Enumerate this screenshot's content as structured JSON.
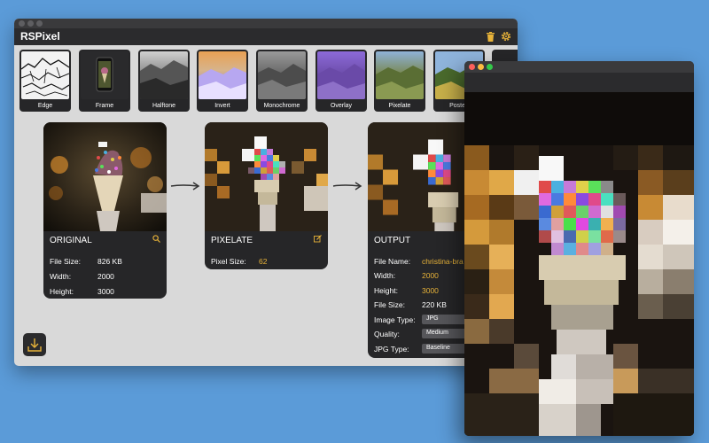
{
  "app": {
    "title": "RSPixel"
  },
  "filters": [
    {
      "label": "Edge"
    },
    {
      "label": "Frame"
    },
    {
      "label": "Halftone"
    },
    {
      "label": "Invert"
    },
    {
      "label": "Monochrome"
    },
    {
      "label": "Overlay"
    },
    {
      "label": "Pixelate"
    },
    {
      "label": "Posteri"
    }
  ],
  "original": {
    "heading": "ORIGINAL",
    "icon": "magnifier-icon",
    "file_size_label": "File Size:",
    "file_size": "826 KB",
    "width_label": "Width:",
    "width": "2000",
    "height_label": "Height:",
    "height": "3000"
  },
  "pixelate": {
    "heading": "PIXELATE",
    "icon": "edit-icon",
    "pixel_size_label": "Pixel Size:",
    "pixel_size": "62"
  },
  "output": {
    "heading": "OUTPUT",
    "file_name_label": "File Name:",
    "file_name": "christina-bra",
    "width_label": "Width:",
    "width": "2000",
    "height_label": "Height:",
    "height": "3000",
    "file_size_label": "File Size:",
    "file_size": "220 KB",
    "image_type_label": "Image Type:",
    "image_type": "JPG",
    "quality_label": "Quality:",
    "quality": "Medium",
    "jpg_type_label": "JPG Type:",
    "jpg_type": "Baseline"
  },
  "colors": {
    "accent": "#e8b339",
    "desktop": "#5b9bd8",
    "card": "#262628",
    "close": "#fc605b",
    "minimize": "#fdbc40",
    "zoom": "#34c84a"
  }
}
